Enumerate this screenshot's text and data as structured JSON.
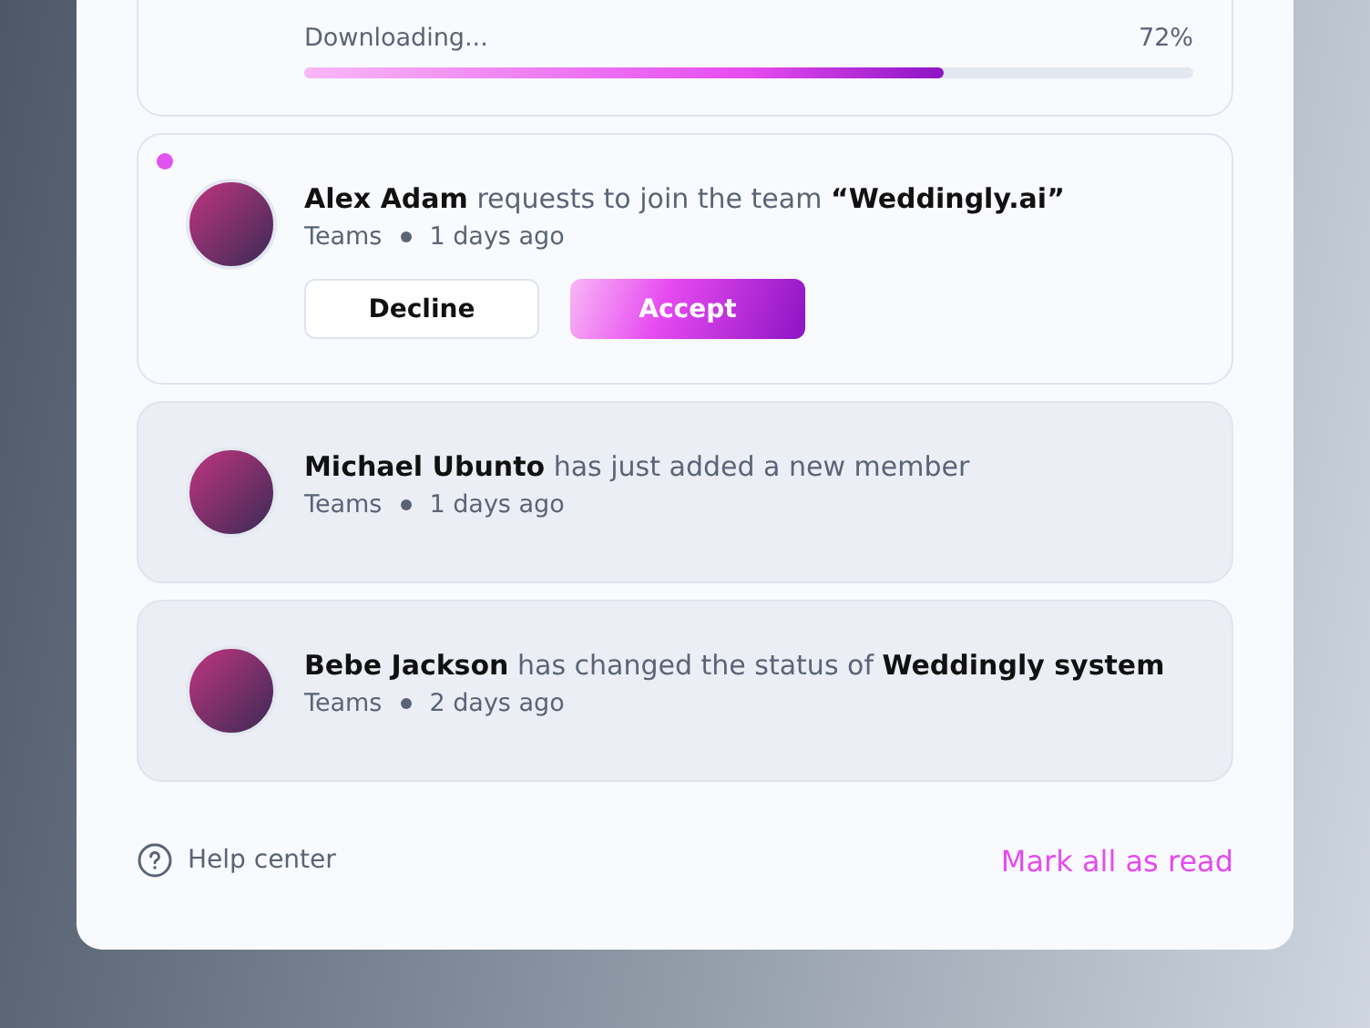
{
  "notifications": [
    {
      "kind": "download",
      "status": "Downloading...",
      "percent": "72%",
      "level": 0.72
    },
    {
      "kind": "request",
      "unread": true,
      "message": "**Alex Adam** requests to join the team **“Weddingly.ai”**",
      "category": "Teams",
      "time": "1 days ago",
      "buttons": [
        {
          "label": "Decline",
          "kind": "secondary"
        },
        {
          "label": "Accept",
          "kind": "primary"
        }
      ]
    },
    {
      "kind": "info",
      "unread": false,
      "message": "**Michael Ubunto** has just added a new member",
      "category": "Teams",
      "time": "1 days ago"
    },
    {
      "kind": "info",
      "unread": false,
      "message": "**Bebe Jackson** has changed the status of **Weddingly system**",
      "category": "Teams",
      "time": "2 days ago"
    }
  ],
  "footer": {
    "help": "Help center",
    "mark_all": "Mark all as read"
  }
}
